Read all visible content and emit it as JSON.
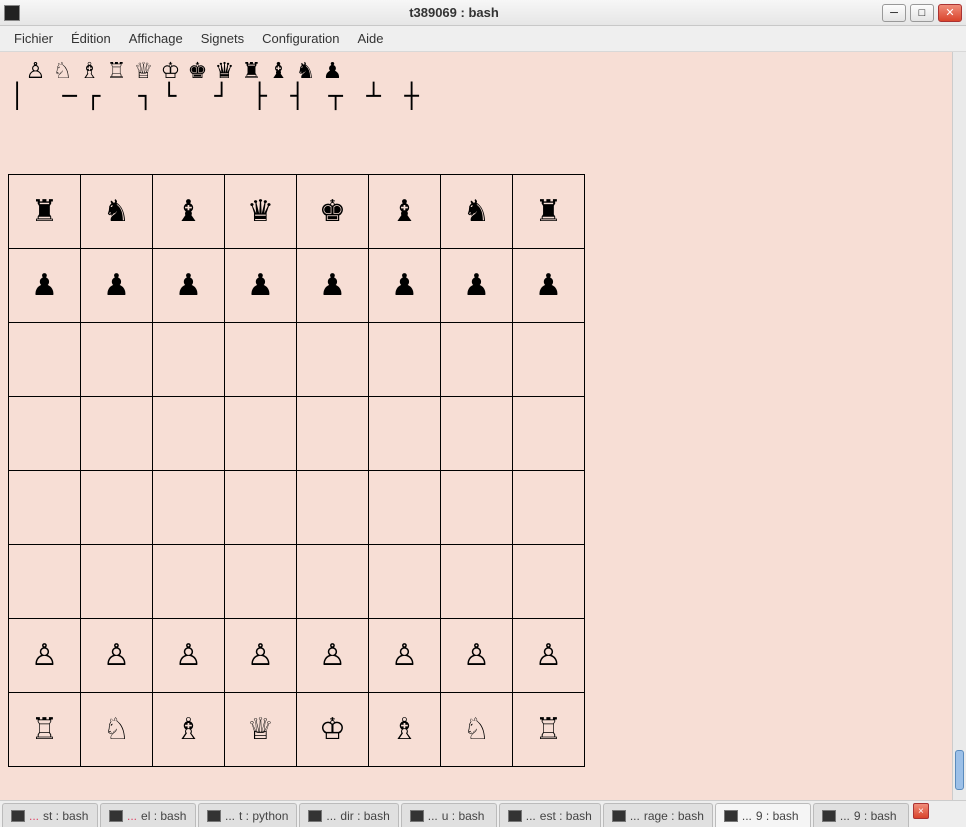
{
  "window": {
    "title": "t389069 : bash"
  },
  "menu": {
    "items": [
      "Fichier",
      "Édition",
      "Affichage",
      "Signets",
      "Configuration",
      "Aide"
    ]
  },
  "piece_row": [
    "♙",
    "♘",
    "♗",
    "♖",
    "♕",
    "♔",
    "♚",
    "♛",
    "♜",
    "♝",
    "♞",
    "♟"
  ],
  "boxdraw_row": [
    "│ ",
    " ─",
    "┌ ",
    " ┐",
    "└ ",
    " ┘",
    " ├",
    " ┤",
    " ┬",
    " ┴",
    " ┼"
  ],
  "board": [
    [
      "♜",
      "♞",
      "♝",
      "♛",
      "♚",
      "♝",
      "♞",
      "♜"
    ],
    [
      "♟",
      "♟",
      "♟",
      "♟",
      "♟",
      "♟",
      "♟",
      "♟"
    ],
    [
      "",
      "",
      "",
      "",
      "",
      "",
      "",
      ""
    ],
    [
      "",
      "",
      "",
      "",
      "",
      "",
      "",
      ""
    ],
    [
      "",
      "",
      "",
      "",
      "",
      "",
      "",
      ""
    ],
    [
      "",
      "",
      "",
      "",
      "",
      "",
      "",
      ""
    ],
    [
      "♙",
      "♙",
      "♙",
      "♙",
      "♙",
      "♙",
      "♙",
      "♙"
    ],
    [
      "♖",
      "♘",
      "♗",
      "♕",
      "♔",
      "♗",
      "♘",
      "♖"
    ]
  ],
  "tabs": [
    {
      "prefix": "...",
      "label": "st : bash",
      "pink": true
    },
    {
      "prefix": "...",
      "label": "el : bash",
      "pink": true
    },
    {
      "prefix": "...",
      "label": "t : python",
      "pink": false
    },
    {
      "prefix": "...",
      "label": "dir : bash",
      "pink": false
    },
    {
      "prefix": "...",
      "label": "u : bash",
      "pink": false
    },
    {
      "prefix": "...",
      "label": "est : bash",
      "pink": false
    },
    {
      "prefix": "...",
      "label": "rage : bash",
      "pink": false
    },
    {
      "prefix": "...",
      "label": "9 : bash",
      "pink": false,
      "active": true
    },
    {
      "prefix": "...",
      "label": "9 : bash",
      "pink": false
    }
  ]
}
